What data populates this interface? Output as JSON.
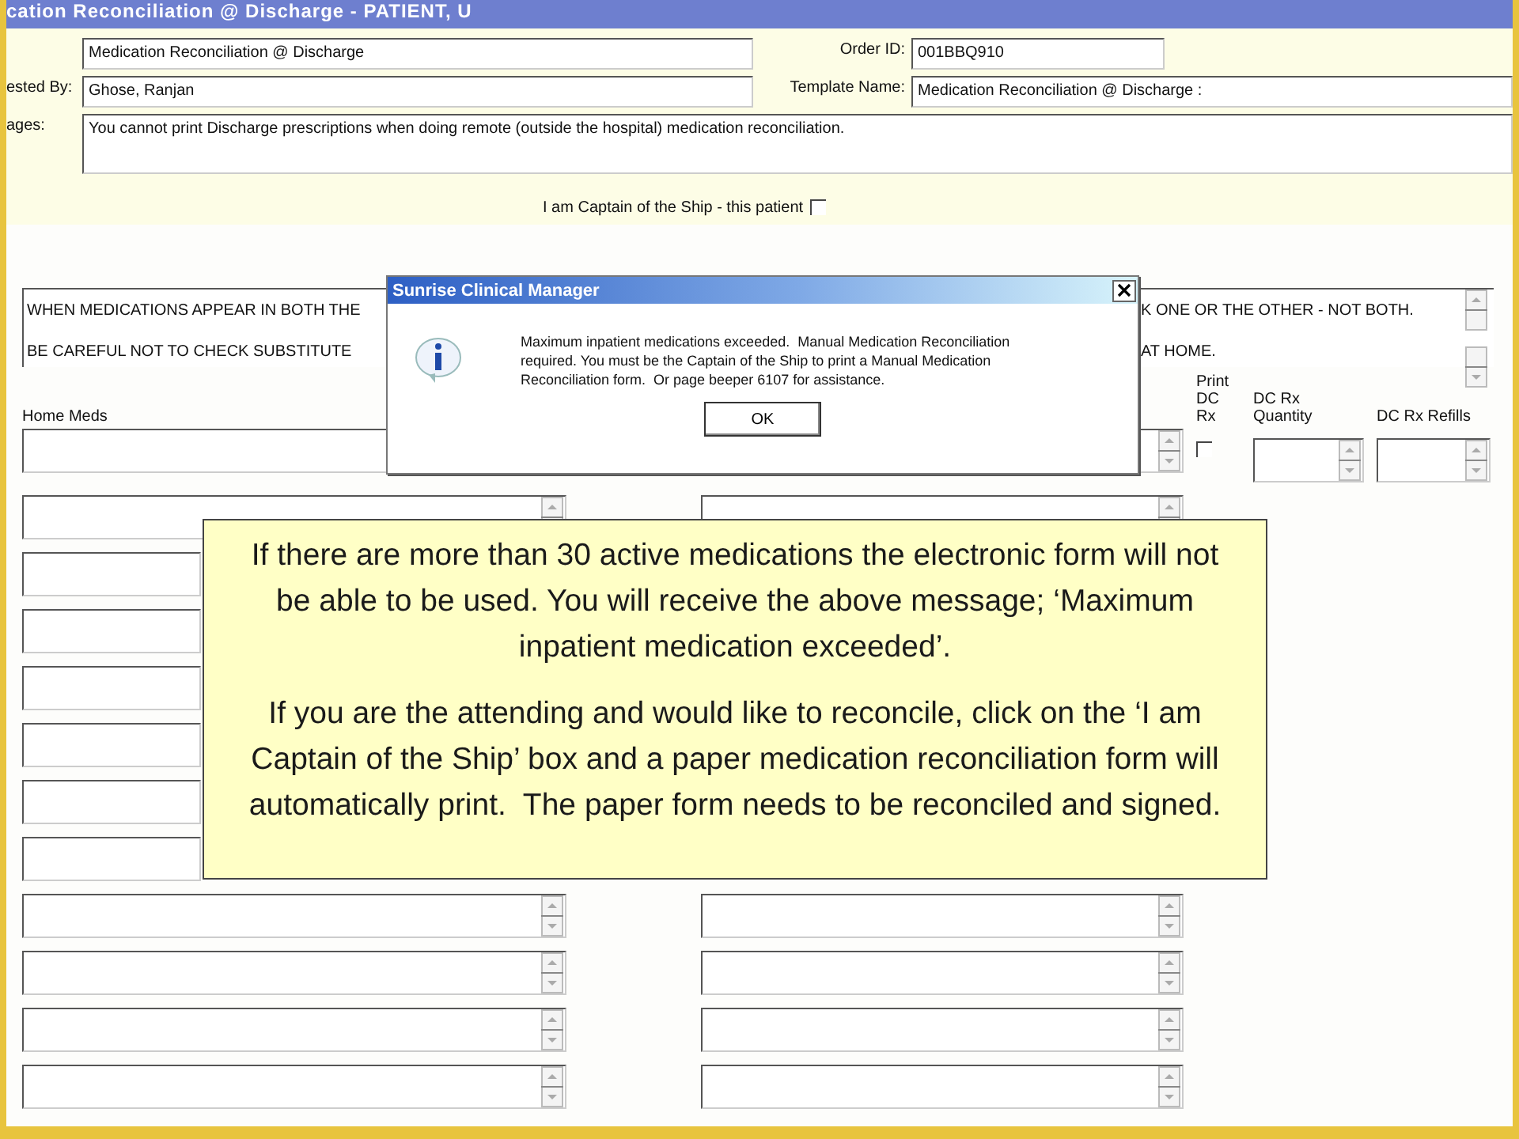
{
  "window": {
    "title": "cation Reconciliation @ Discharge - PATIENT, U"
  },
  "header": {
    "order_name": {
      "value": "Medication Reconciliation @ Discharge"
    },
    "order_id": {
      "label": "Order ID:",
      "value": "001BBQ910"
    },
    "requested_by": {
      "label": "ested By:",
      "value": "Ghose, Ranjan"
    },
    "template_name": {
      "label": "Template Name:",
      "value": "Medication Reconciliation @ Discharge :"
    },
    "messages": {
      "label": "ages:",
      "value": "You cannot print Discharge prescriptions when doing remote (outside the hospital) medication reconciliation."
    }
  },
  "captain_checkbox": {
    "label": "I am Captain of the Ship - this patient",
    "checked": false
  },
  "instructions": [
    {
      "left": "WHEN MEDICATIONS APPEAR IN BOTH THE",
      "right": "K ONE OR THE OTHER - NOT BOTH."
    },
    {
      "left": "BE CAREFUL NOT TO CHECK SUBSTITUTE",
      "right": "AT HOME."
    }
  ],
  "columns": {
    "home_meds": "Home Meds",
    "print_dc_rx": {
      "label": "Print DC Rx",
      "checked": false
    },
    "dc_rx_quantity": "DC Rx Quantity",
    "dc_rx_refills": "DC Rx Refills"
  },
  "dialog": {
    "title": "Sunrise Clinical Manager",
    "message": "Maximum inpatient medications exceeded.  Manual Medication Reconciliation required. You must be the Captain of the Ship to print a Manual Medication Reconciliation form.  Or page beeper 6107 for assistance.",
    "buttons": [
      "OK"
    ]
  },
  "callout": {
    "paragraphs": [
      "If there are more than 30 active medications the electronic form will not be able to be used. You will receive the above message; ‘Maximum inpatient medication exceeded’.",
      "If you are the attending and would like to reconcile, click on the ‘I am Captain of the Ship’ box and a paper medication reconciliation form will automatically print.  The paper form needs to be reconciled and signed."
    ]
  }
}
